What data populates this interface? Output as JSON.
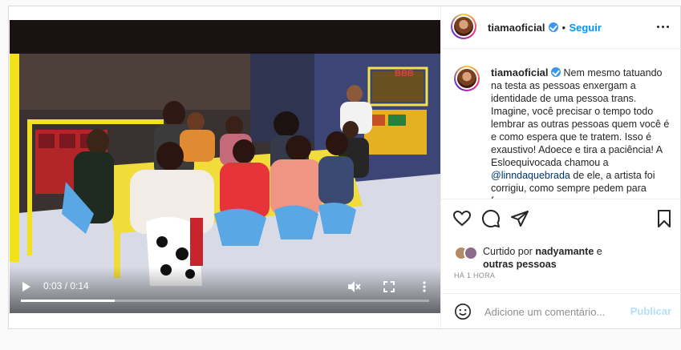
{
  "post": {
    "username": "tiamaoficial",
    "follow_label": "Seguir",
    "caption_pre_mention": "Nem mesmo tatuando na testa as pessoas enxergam a identidade de uma pessoa trans. Imagine, você precisar o tempo todo lembrar as outras pessoas quem você é e como espera que te tratem. Isso é exaustivo! Adoece e tira a paciência! A Esloequivocada chamou a",
    "mention": "@linndaquebrada",
    "caption_post_mention": "de ele, a artista foi corrigiu, como sempre pedem para fazer.",
    "liked_by_prefix": "Curtido por",
    "liked_by_user": "nadyamante",
    "liked_by_suffix": "e",
    "liked_by_others": "outras pessoas",
    "time_ago": "HÁ 1 HORA",
    "comment_placeholder": "Adicione um comentário...",
    "publish_label": "Publicar"
  },
  "video": {
    "current_time": "0:03",
    "duration": "0:14",
    "time_display": "0:03 / 0:14",
    "progress_fraction": 0.23,
    "watermark": "BBB",
    "icons": [
      "play-icon",
      "volume-muted-icon",
      "fullscreen-icon",
      "more-vertical-icon"
    ]
  },
  "icons": {
    "actions": [
      "heart-icon",
      "comment-icon",
      "share-icon",
      "bookmark-icon"
    ],
    "comment": "emoji-icon"
  },
  "colors": {
    "link": "#0095f6",
    "mention": "#00376b",
    "verified": "#3897f0",
    "muted": "#8e8e8e",
    "publish_disabled": "#b2dffc"
  }
}
